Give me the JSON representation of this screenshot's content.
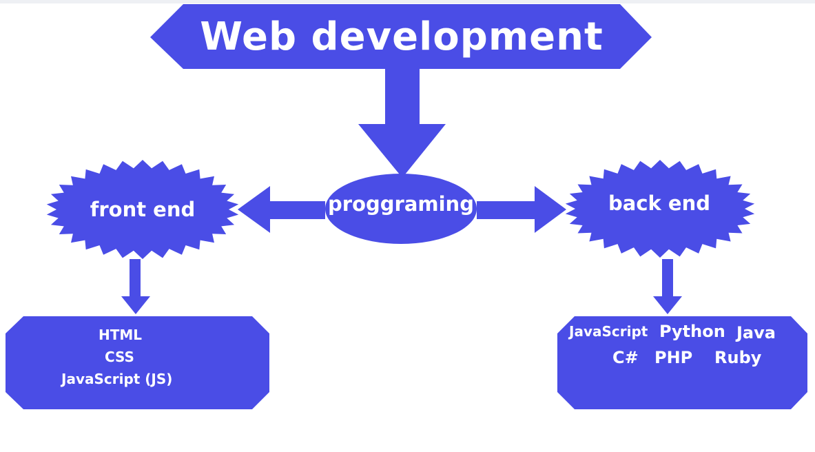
{
  "colors": {
    "shape_fill": "#4a4de6",
    "text": "#ffffff",
    "background": "#ffffff"
  },
  "title": "Web development",
  "center": "proggraming",
  "front_end": {
    "label": "front end",
    "items": [
      "HTML",
      "CSS",
      "JavaScript (JS)"
    ]
  },
  "back_end": {
    "label": "back end",
    "items": [
      "JavaScript",
      "Python",
      "Java",
      "C#",
      "PHP",
      "Ruby"
    ]
  }
}
